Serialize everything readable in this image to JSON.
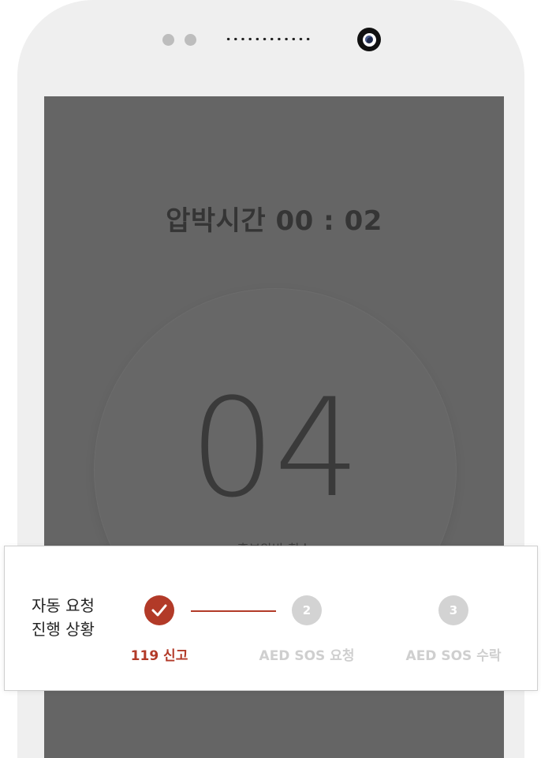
{
  "device": {
    "camera_icon": "camera-icon",
    "sensor_icon": "sensor-dots"
  },
  "screen": {
    "timer_text": "압박시간 00 : 02",
    "counter_value": "04",
    "counter_sublabel": "흉부압박 횟수"
  },
  "progress_panel": {
    "title_line1": "자동 요청",
    "title_line2": "진행 상황",
    "steps": [
      {
        "number": "✓",
        "label": "119 신고",
        "status": "done",
        "icon": "check-icon"
      },
      {
        "number": "2",
        "label": "AED SOS 요청",
        "status": "pending"
      },
      {
        "number": "3",
        "label": "AED SOS 수락",
        "status": "pending"
      }
    ],
    "colors": {
      "active": "#b23a28",
      "inactive": "#d3d3d3"
    }
  }
}
